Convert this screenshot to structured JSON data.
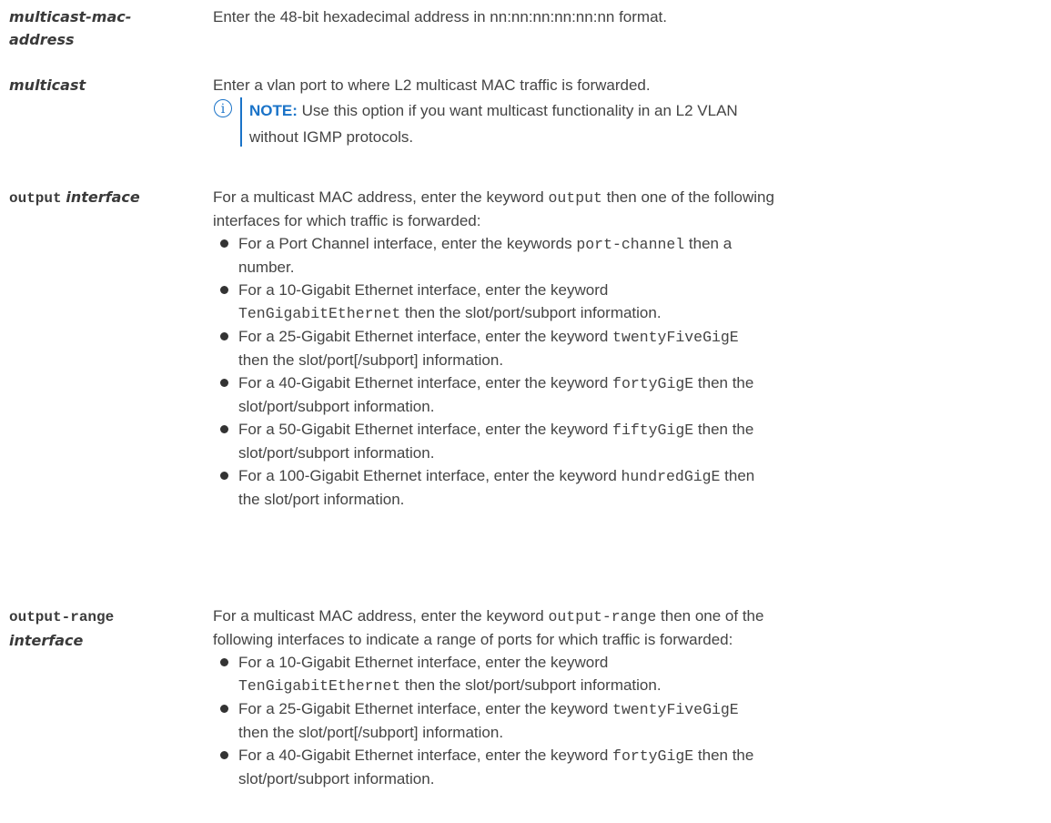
{
  "rows": {
    "mac": {
      "term_line1": "multicast-mac-",
      "term_line2": "address",
      "desc": "Enter the 48-bit hexadecimal address in nn:nn:nn:nn:nn:nn format."
    },
    "multicast": {
      "term": "multicast",
      "desc": "Enter a vlan port to where L2 multicast MAC traffic is forwarded.",
      "note_label": "NOTE:",
      "note_text_1": " Use this option if you want multicast functionality in an L2 VLAN",
      "note_text_2": "without IGMP protocols."
    },
    "output": {
      "term_code": "output",
      "term_italic": "interface",
      "intro_1": "For a multicast MAC address, enter the keyword ",
      "intro_code": "output",
      "intro_2": " then one of the following",
      "intro_3": "interfaces for which traffic is forwarded:",
      "items": [
        {
          "a": "For a Port Channel interface, enter the keywords ",
          "code": "port-channel",
          "b": " then a",
          "c": "number."
        },
        {
          "a": "For a 10-Gigabit Ethernet interface, enter the keyword",
          "code": "TenGigabitEthernet",
          "b": " then the slot/port/subport information."
        },
        {
          "a": "For a 25-Gigabit Ethernet interface, enter the keyword ",
          "code": "twentyFiveGigE",
          "b": "then the slot/port[/subport] information."
        },
        {
          "a": "For a 40-Gigabit Ethernet interface, enter the keyword ",
          "code": "fortyGigE",
          "b": " then the",
          "c": "slot/port/subport information."
        },
        {
          "a": "For a 50-Gigabit Ethernet interface, enter the keyword ",
          "code": "fiftyGigE",
          "b": " then the",
          "c": "slot/port/subport information."
        },
        {
          "a": "For a 100-Gigabit Ethernet interface, enter the keyword ",
          "code": "hundredGigE",
          "b": " then",
          "c": "the slot/port information."
        }
      ]
    },
    "output_range": {
      "term_code": "output-range",
      "term_italic": "interface",
      "intro_1": "For a multicast MAC address, enter the keyword ",
      "intro_code": "output-range",
      "intro_2": " then one of the",
      "intro_3": "following interfaces to indicate a range of ports for which traffic is forwarded:",
      "items": [
        {
          "a": "For a 10-Gigabit Ethernet interface, enter the keyword",
          "code": "TenGigabitEthernet",
          "b": " then the slot/port/subport information."
        },
        {
          "a": "For a 25-Gigabit Ethernet interface, enter the keyword ",
          "code": "twentyFiveGigE",
          "b": "then the slot/port[/subport] information."
        },
        {
          "a": "For a 40-Gigabit Ethernet interface, enter the keyword ",
          "code": "fortyGigE",
          "b": " then the",
          "c": "slot/port/subport information."
        }
      ]
    }
  },
  "colors": {
    "note_accent": "#1a73c8",
    "text": "#444444"
  },
  "icons": {
    "note": "info-circle-icon"
  }
}
